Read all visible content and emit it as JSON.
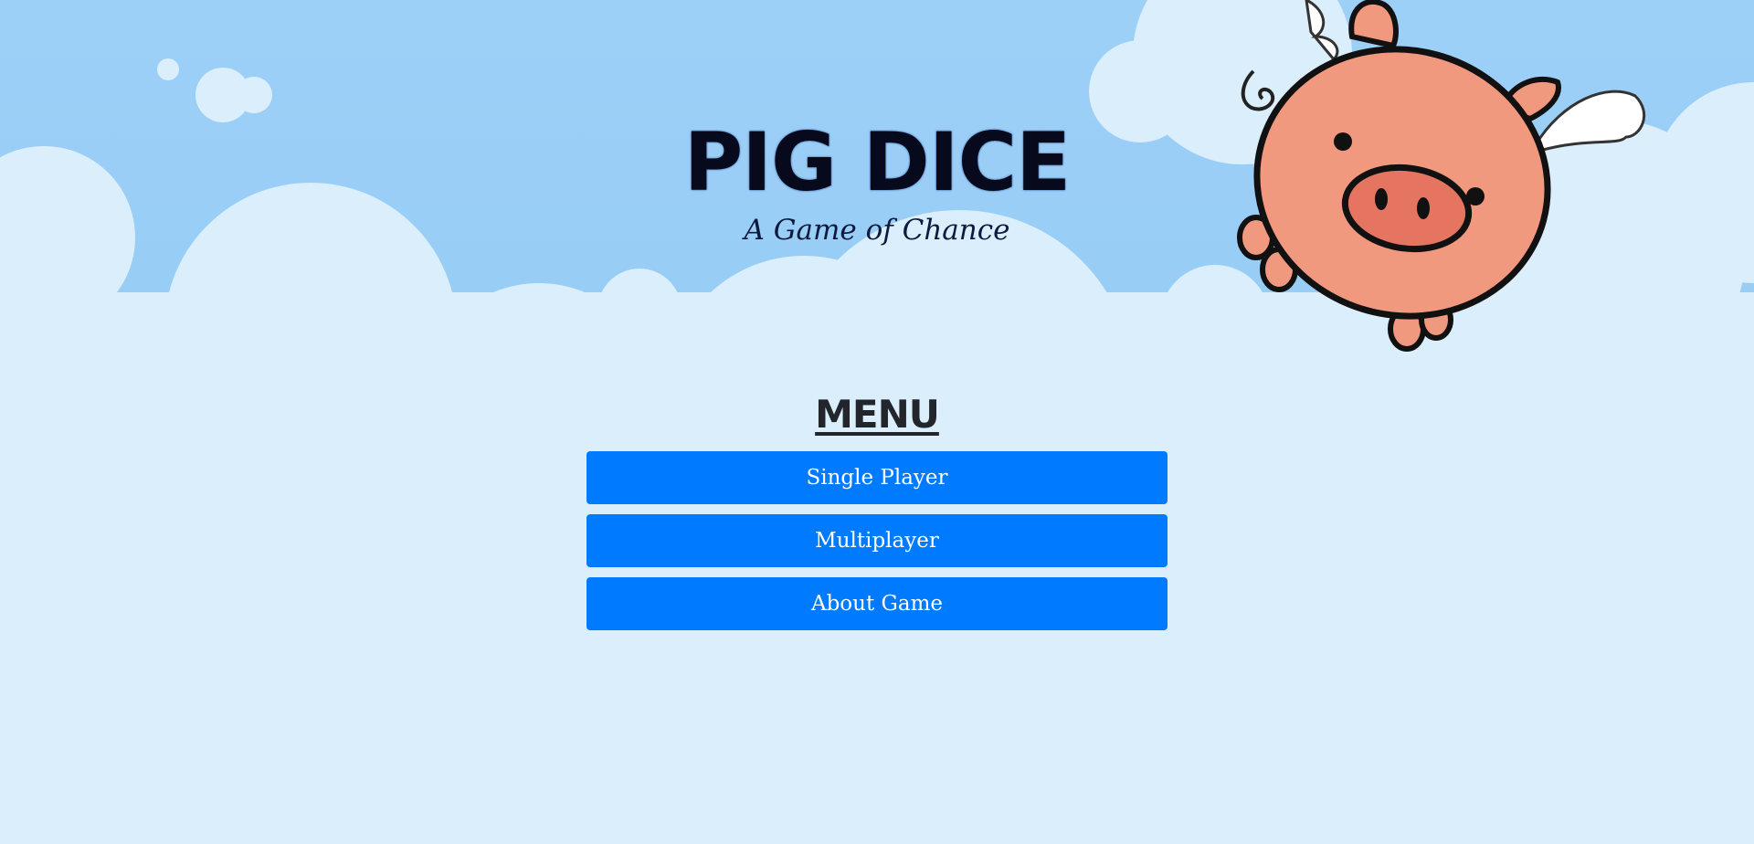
{
  "header": {
    "title": "PIG DICE",
    "subtitle": "A Game of Chance"
  },
  "menu": {
    "heading": "MENU",
    "buttons": [
      {
        "label": "Single Player"
      },
      {
        "label": "Multiplayer"
      },
      {
        "label": "About Game"
      }
    ]
  },
  "colors": {
    "sky_top": "#92c9f5",
    "cloud": "#dbeefb",
    "button": "#007bff",
    "pig_body": "#f0997f",
    "pig_snout": "#e57561"
  },
  "icons": {
    "mascot": "flying-pig-icon"
  }
}
